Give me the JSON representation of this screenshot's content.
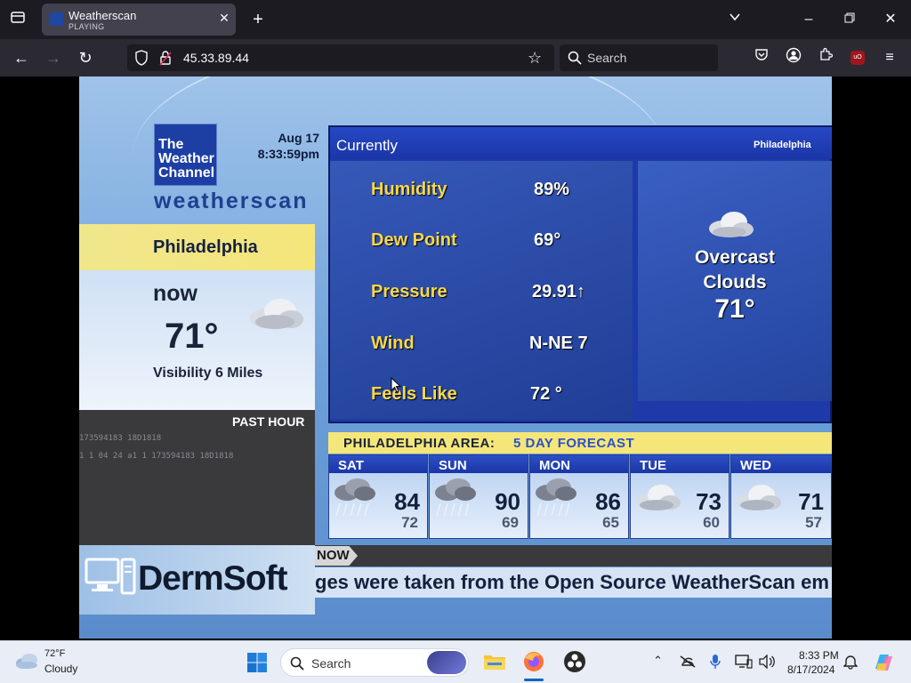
{
  "browser": {
    "tab_title": "Weatherscan",
    "tab_status": "PLAYING",
    "url": "45.33.89.44",
    "search_placeholder": "Search"
  },
  "weatherscan": {
    "logo_text": "The Weather Channel",
    "brand": "weatherscan",
    "date": "Aug 17",
    "time": "8:33:59pm",
    "city": "Philadelphia",
    "now_label": "now",
    "now_temp": "71°",
    "visibility": "Visibility 6 Miles",
    "past_hour_label": "PAST HOUR",
    "past_data_1": "173594183 18D1818",
    "past_data_2": "1 1 04 24 a1 1 173594183 18D1818",
    "sponsor": "DermSoft",
    "current": {
      "title": "Currently",
      "city": "Philadelphia",
      "conditions": [
        {
          "label": "Humidity",
          "value": "89%"
        },
        {
          "label": "Dew Point",
          "value": "69°"
        },
        {
          "label": "Pressure",
          "value": "29.91↑"
        },
        {
          "label": "Wind",
          "value": "N-NE 7"
        },
        {
          "label": "Feels Like",
          "value": "72 °"
        }
      ],
      "summary_line1": "Overcast",
      "summary_line2": "Clouds",
      "summary_temp": "71°"
    },
    "forecast": {
      "region": "PHILADELPHIA AREA:",
      "title": "5 DAY FORECAST",
      "days": [
        {
          "day": "SAT",
          "hi": "84",
          "lo": "72",
          "icon": "rain-cloud-icon"
        },
        {
          "day": "SUN",
          "hi": "90",
          "lo": "69",
          "icon": "rain-cloud-icon"
        },
        {
          "day": "MON",
          "hi": "86",
          "lo": "65",
          "icon": "rain-cloud-icon"
        },
        {
          "day": "TUE",
          "hi": "73",
          "lo": "60",
          "icon": "cloud-icon"
        },
        {
          "day": "WED",
          "hi": "71",
          "lo": "57",
          "icon": "cloud-icon"
        }
      ]
    },
    "ticker_label": "NOW",
    "ticker_text": "ges were taken from the Open Source WeatherScan em"
  },
  "taskbar": {
    "weather_temp": "72°F",
    "weather_cond": "Cloudy",
    "search_label": "Search",
    "time": "8:33 PM",
    "date": "8/17/2024"
  }
}
